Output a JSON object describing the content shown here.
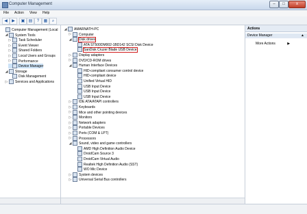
{
  "window": {
    "title": "Computer Management"
  },
  "menu": [
    "File",
    "Action",
    "View",
    "Help"
  ],
  "left_tree": [
    {
      "label": "Computer Management (Local",
      "indent": 0,
      "toggle": "",
      "selected": false
    },
    {
      "label": "System Tools",
      "indent": 1,
      "toggle": "◢",
      "selected": false
    },
    {
      "label": "Task Scheduler",
      "indent": 2,
      "toggle": "▷",
      "selected": false
    },
    {
      "label": "Event Viewer",
      "indent": 2,
      "toggle": "▷",
      "selected": false
    },
    {
      "label": "Shared Folders",
      "indent": 2,
      "toggle": "▷",
      "selected": false
    },
    {
      "label": "Local Users and Groups",
      "indent": 2,
      "toggle": "▷",
      "selected": false
    },
    {
      "label": "Performance",
      "indent": 2,
      "toggle": "▷",
      "selected": false
    },
    {
      "label": "Device Manager",
      "indent": 2,
      "toggle": "",
      "selected": true
    },
    {
      "label": "Storage",
      "indent": 1,
      "toggle": "◢",
      "selected": false
    },
    {
      "label": "Disk Management",
      "indent": 2,
      "toggle": "",
      "selected": false
    },
    {
      "label": "Services and Applications",
      "indent": 1,
      "toggle": "▷",
      "selected": false
    }
  ],
  "device_tree": [
    {
      "label": "AMARNATH-PC",
      "indent": 0,
      "toggle": "◢",
      "hl": false
    },
    {
      "label": "Computer",
      "indent": 1,
      "toggle": "▷",
      "hl": false
    },
    {
      "label": "Disk drives",
      "indent": 1,
      "toggle": "◢",
      "hl": true
    },
    {
      "label": "ATA ST500DM002-1BD142 SCSI Disk Device",
      "indent": 2,
      "toggle": "",
      "hl": false
    },
    {
      "label": "SanDisk Cruzer Blade USB Device",
      "indent": 2,
      "toggle": "",
      "hl": true
    },
    {
      "label": "Display adapters",
      "indent": 1,
      "toggle": "▷",
      "hl": false
    },
    {
      "label": "DVD/CD-ROM drives",
      "indent": 1,
      "toggle": "▷",
      "hl": false
    },
    {
      "label": "Human Interface Devices",
      "indent": 1,
      "toggle": "◢",
      "hl": false
    },
    {
      "label": "HID-compliant consumer control device",
      "indent": 2,
      "toggle": "",
      "hl": false
    },
    {
      "label": "HID-compliant device",
      "indent": 2,
      "toggle": "",
      "hl": false
    },
    {
      "label": "Unified Virtual HID",
      "indent": 2,
      "toggle": "",
      "hl": false
    },
    {
      "label": "USB Input Device",
      "indent": 2,
      "toggle": "",
      "hl": false
    },
    {
      "label": "USB Input Device",
      "indent": 2,
      "toggle": "",
      "hl": false
    },
    {
      "label": "USB Input Device",
      "indent": 2,
      "toggle": "",
      "hl": false
    },
    {
      "label": "IDE ATA/ATAPI controllers",
      "indent": 1,
      "toggle": "▷",
      "hl": false
    },
    {
      "label": "Keyboards",
      "indent": 1,
      "toggle": "▷",
      "hl": false
    },
    {
      "label": "Mice and other pointing devices",
      "indent": 1,
      "toggle": "▷",
      "hl": false
    },
    {
      "label": "Monitors",
      "indent": 1,
      "toggle": "▷",
      "hl": false
    },
    {
      "label": "Network adapters",
      "indent": 1,
      "toggle": "▷",
      "hl": false
    },
    {
      "label": "Portable Devices",
      "indent": 1,
      "toggle": "▷",
      "hl": false
    },
    {
      "label": "Ports (COM & LPT)",
      "indent": 1,
      "toggle": "▷",
      "hl": false
    },
    {
      "label": "Processors",
      "indent": 1,
      "toggle": "▷",
      "hl": false
    },
    {
      "label": "Sound, video and game controllers",
      "indent": 1,
      "toggle": "◢",
      "hl": false
    },
    {
      "label": "AMD High Definition Audio Device",
      "indent": 2,
      "toggle": "",
      "hl": false
    },
    {
      "label": "DroidCam Source 3",
      "indent": 2,
      "toggle": "",
      "hl": false
    },
    {
      "label": "DroidCam Virtual Audio",
      "indent": 2,
      "toggle": "",
      "hl": false
    },
    {
      "label": "Realtek High Definition Audio (SST)",
      "indent": 2,
      "toggle": "",
      "hl": false
    },
    {
      "label": "WO Mic Device",
      "indent": 2,
      "toggle": "",
      "hl": false
    },
    {
      "label": "System devices",
      "indent": 1,
      "toggle": "▷",
      "hl": false
    },
    {
      "label": "Universal Serial Bus controllers",
      "indent": 1,
      "toggle": "▷",
      "hl": false
    }
  ],
  "actions": {
    "header": "Actions",
    "section": "Device Manager",
    "more": "More Actions"
  },
  "colors": {
    "highlight": "#d01a1a",
    "selection": "#cde3f7"
  }
}
